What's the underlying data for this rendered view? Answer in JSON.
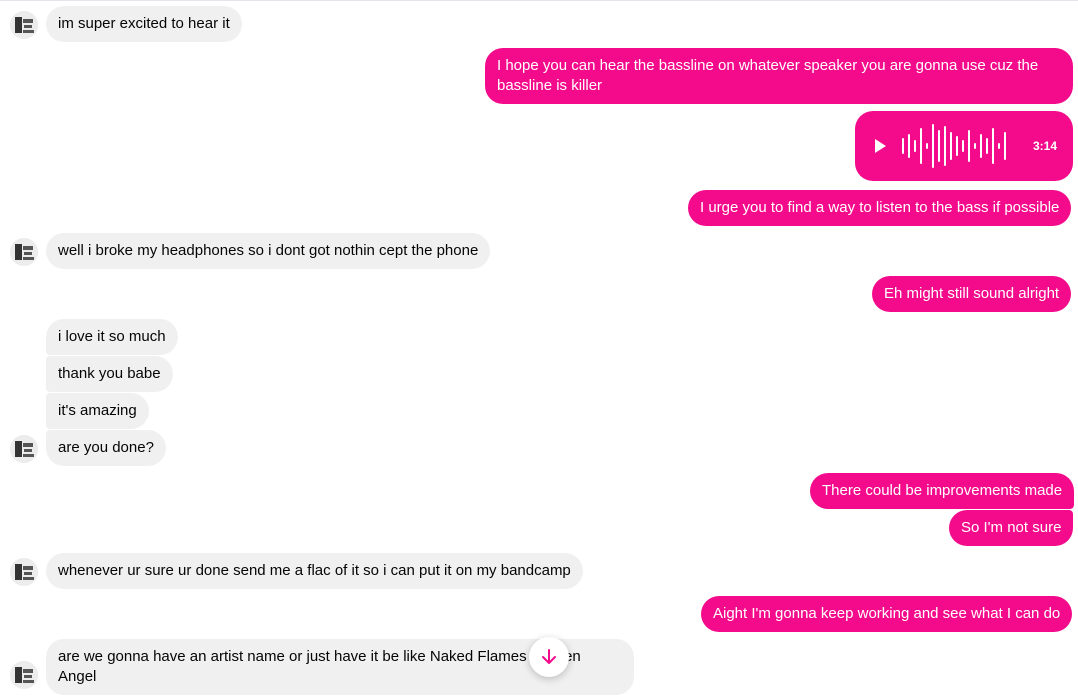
{
  "conversation": {
    "messages": [
      {
        "text": "im super excited to hear it"
      },
      {
        "text": "I hope you can hear the bassline on whatever speaker you are gonna use cuz the bassline is killer"
      },
      {
        "type": "audio",
        "duration": "3:14"
      },
      {
        "text": "I urge you to find a way to listen to the bass if possible"
      },
      {
        "text": "well i broke my headphones so i dont got nothin cept the phone"
      },
      {
        "text": "Eh might still sound alright"
      },
      {
        "text": "i love it so much"
      },
      {
        "text": "thank you babe"
      },
      {
        "text": "it's amazing"
      },
      {
        "text": "are you done?"
      },
      {
        "text": "There could be improvements made"
      },
      {
        "text": "So I'm not sure"
      },
      {
        "text": "whenever ur sure ur done send me a flac of it so i can put it on my bandcamp"
      },
      {
        "text": "Aight I'm gonna keep working and see what I can do"
      },
      {
        "text": "are we gonna have an artist name or just have it be like Naked Flames x Arsen Angel"
      }
    ]
  },
  "colors": {
    "outgoing_bubble": "#f40b8b",
    "incoming_bubble": "#f0f0f0"
  },
  "icons": {
    "audio_play": "play-icon",
    "scroll": "arrow-down-icon",
    "avatar": "contact-avatar"
  }
}
